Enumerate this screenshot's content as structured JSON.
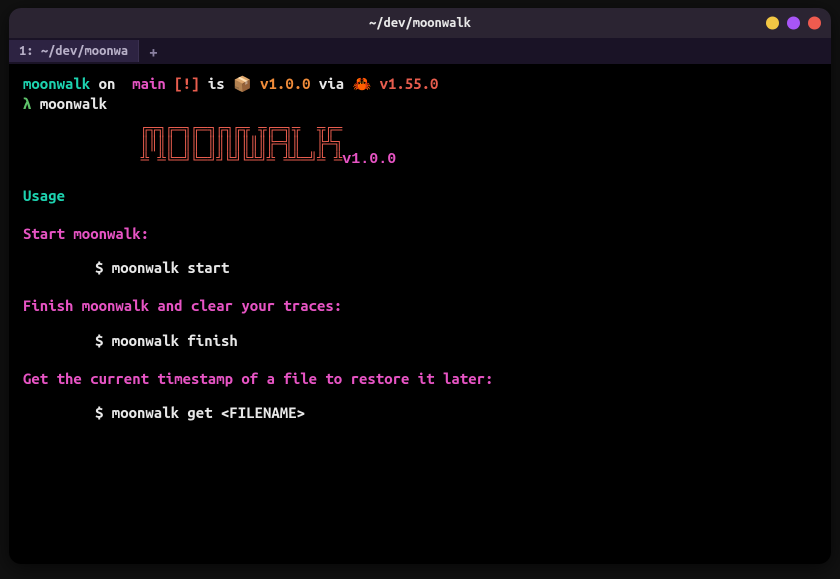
{
  "window": {
    "title": "~/dev/moonwalk"
  },
  "tabs": {
    "first": "1: ~/dev/moonwa",
    "add": "+"
  },
  "prompt": {
    "proj": "moonwalk",
    "on": " on ",
    "branch_icon": "",
    "branch": " main ",
    "flags": "[!]",
    "is": " is ",
    "pkg_icon": "📦",
    "version1": " v1.0.0 ",
    "via": "via ",
    "crab": "🦀",
    "version2": " v1.55.0",
    "lambda": "λ ",
    "command": "moonwalk"
  },
  "ascii": {
    "art": "              ╔╦╗╔═╗╔═╗╔╗╔╦ ╦╔═╗╦  ╦╔═\n              ║║║║ ║║ ║║║║║║║╠═╣║  ╠╩╗\n              ╩ ╩╚═╝╚═╝╝╚╝╚╩╝╩ ╩╩═╝╩ ╩",
    "ver": "v1.0.0"
  },
  "usage": {
    "heading": "Usage",
    "s1": {
      "desc": "Start moonwalk:",
      "cmd": "$ moonwalk start"
    },
    "s2": {
      "desc": "Finish moonwalk and clear your traces:",
      "cmd": "$ moonwalk finish"
    },
    "s3": {
      "desc": "Get the current timestamp of a file to restore it later:",
      "cmd": "$ moonwalk get <FILENAME>"
    }
  }
}
